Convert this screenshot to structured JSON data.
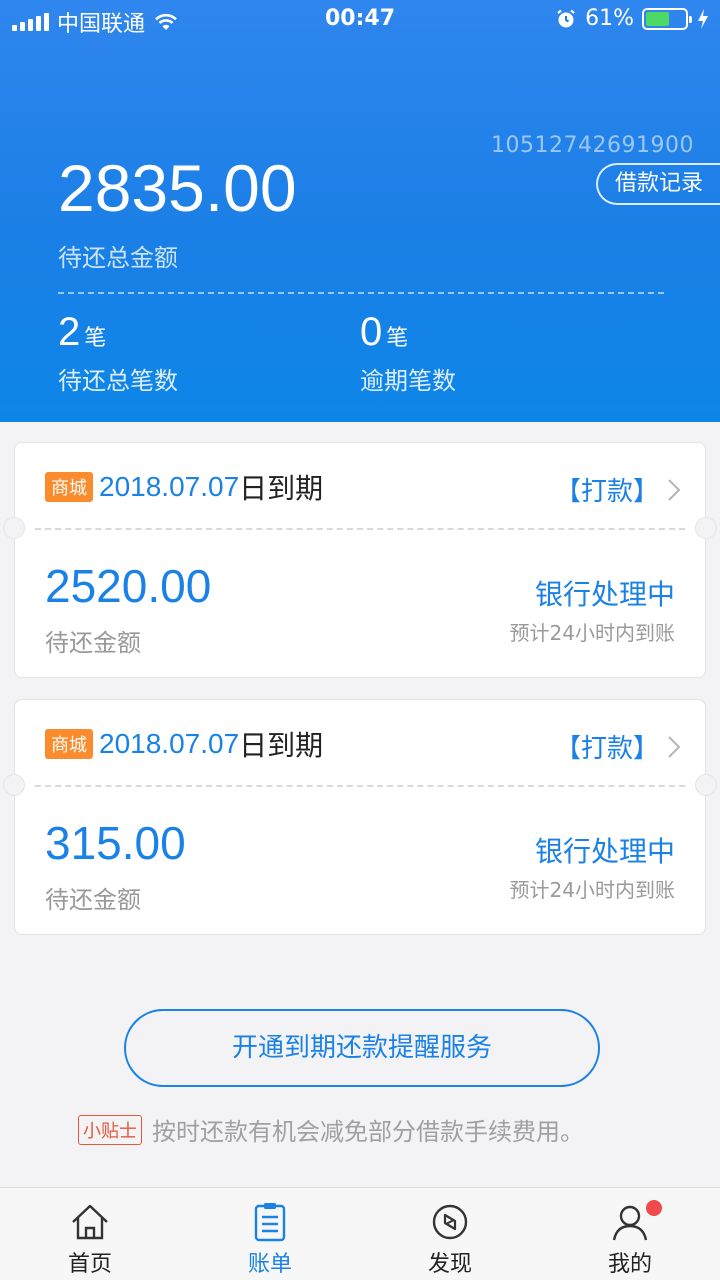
{
  "status_bar": {
    "carrier": "中国联通",
    "time": "00:47",
    "battery": "61%"
  },
  "summary": {
    "account_number": "10512742691900",
    "record_button": "借款记录",
    "total_amount": "2835.00",
    "total_label": "待还总金额",
    "pending_count": "2",
    "pending_unit": "笔",
    "pending_label": "待还总笔数",
    "overdue_count": "0",
    "overdue_unit": "笔",
    "overdue_label": "逾期笔数"
  },
  "loans": [
    {
      "tag": "商城",
      "due_date": "2018.07.07",
      "due_suffix": "日到期",
      "action": "【打款】",
      "amount": "2520.00",
      "amount_label": "待还金额",
      "status": "银行处理中",
      "eta": "预计24小时内到账"
    },
    {
      "tag": "商城",
      "due_date": "2018.07.07",
      "due_suffix": "日到期",
      "action": "【打款】",
      "amount": "315.00",
      "amount_label": "待还金额",
      "status": "银行处理中",
      "eta": "预计24小时内到账"
    }
  ],
  "reminder_button": "开通到期还款提醒服务",
  "tip": {
    "tag": "小贴士",
    "text": "按时还款有机会减免部分借款手续费用。"
  },
  "tabs": [
    {
      "label": "首页",
      "icon": "home-icon"
    },
    {
      "label": "账单",
      "icon": "bill-icon",
      "active": true
    },
    {
      "label": "发现",
      "icon": "compass-icon"
    },
    {
      "label": "我的",
      "icon": "profile-icon"
    }
  ],
  "colors": {
    "primary": "#1a82e6",
    "tag_orange": "#fa8c2e",
    "badge_red": "#f04a4a"
  }
}
